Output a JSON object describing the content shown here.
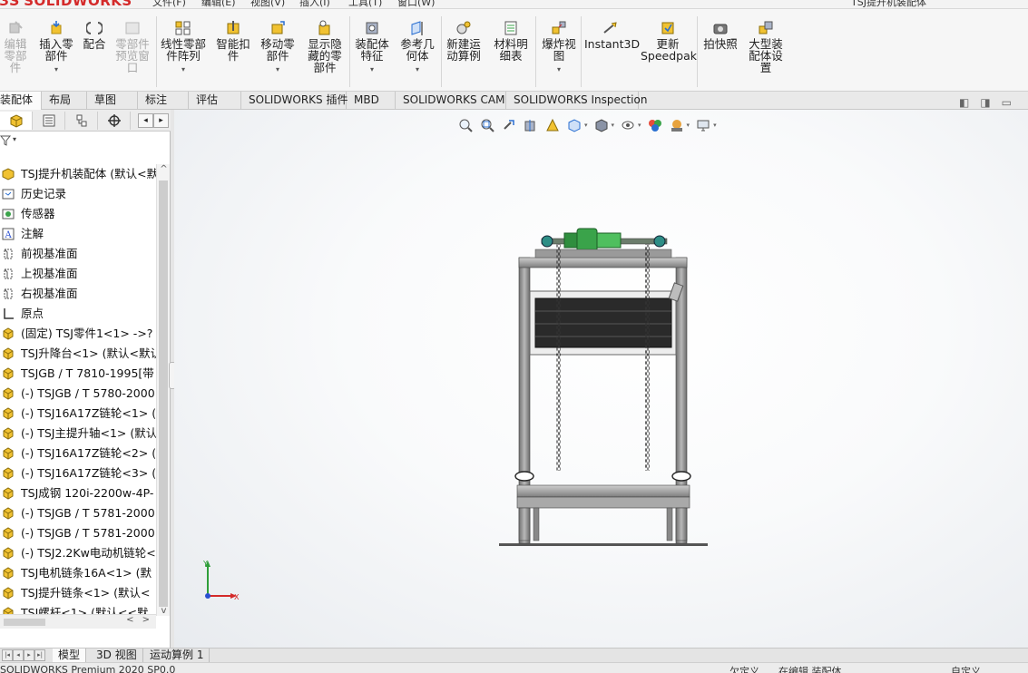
{
  "brand": {
    "name": "SOLIDWORKS"
  },
  "menu": {
    "items": [
      "文件(F)",
      "编辑(E)",
      "视图(V)",
      "插入(I)",
      "工具(T)",
      "窗口(W)"
    ],
    "title": "TSJ提升机装配体"
  },
  "ribbon": {
    "buttons": [
      {
        "label": "编辑零部件",
        "icon": "edit-component-icon",
        "disabled": true
      },
      {
        "label": "插入零部件",
        "icon": "insert-component-icon",
        "disabled": false,
        "dropdown": true
      },
      {
        "label": "配合",
        "icon": "mate-icon",
        "disabled": false
      },
      {
        "label": "零部件预览窗口",
        "icon": "component-preview-icon",
        "disabled": true
      },
      {
        "label": "线性零部件阵列",
        "icon": "linear-pattern-icon",
        "disabled": false,
        "dropdown": true
      },
      {
        "label": "智能扣件",
        "icon": "smart-fasteners-icon",
        "disabled": false
      },
      {
        "label": "移动零部件",
        "icon": "move-component-icon",
        "disabled": false,
        "dropdown": true
      },
      {
        "label": "显示隐藏的零部件",
        "icon": "show-hidden-icon",
        "disabled": false
      },
      {
        "label": "装配体特征",
        "icon": "assembly-feature-icon",
        "disabled": false,
        "dropdown": true
      },
      {
        "label": "参考几何体",
        "icon": "reference-geometry-icon",
        "disabled": false,
        "dropdown": true
      },
      {
        "label": "新建运动算例",
        "icon": "motion-study-icon",
        "disabled": false
      },
      {
        "label": "材料明细表",
        "icon": "bom-icon",
        "disabled": false
      },
      {
        "label": "爆炸视图",
        "icon": "exploded-view-icon",
        "disabled": false,
        "dropdown": true
      },
      {
        "label": "Instant3D",
        "icon": "instant3d-icon",
        "disabled": false
      },
      {
        "label": "更新Speedpak",
        "icon": "speedpak-icon",
        "disabled": false
      },
      {
        "label": "拍快照",
        "icon": "snapshot-icon",
        "disabled": false
      },
      {
        "label": "大型装配体设置",
        "icon": "large-assembly-icon",
        "disabled": false
      }
    ]
  },
  "cm_tabs": [
    "装配体",
    "布局",
    "草图",
    "标注",
    "评估",
    "SOLIDWORKS 插件",
    "MBD",
    "SOLIDWORKS CAM",
    "SOLIDWORKS Inspection"
  ],
  "cm_active": "装配体",
  "feature_tree": {
    "root": "TSJ提升机装配体 (默认<默认",
    "items": [
      {
        "label": "历史记录",
        "icon": "history-icon"
      },
      {
        "label": "传感器",
        "icon": "sensor-icon"
      },
      {
        "label": "注解",
        "icon": "annotation-icon"
      },
      {
        "label": "前视基准面",
        "icon": "plane-icon"
      },
      {
        "label": "上视基准面",
        "icon": "plane-icon"
      },
      {
        "label": "右视基准面",
        "icon": "plane-icon"
      },
      {
        "label": "原点",
        "icon": "origin-icon"
      },
      {
        "label": "(固定) TSJ零件1<1> ->?",
        "icon": "part-icon"
      },
      {
        "label": "TSJ升降台<1> (默认<默认",
        "icon": "part-icon"
      },
      {
        "label": "TSJGB / T 7810-1995[带",
        "icon": "part-icon"
      },
      {
        "label": "(-) TSJGB / T 5780-2000",
        "icon": "part-icon"
      },
      {
        "label": "(-) TSJ16A17Z链轮<1> (",
        "icon": "part-icon"
      },
      {
        "label": "(-) TSJ主提升轴<1> (默认",
        "icon": "part-icon"
      },
      {
        "label": "(-) TSJ16A17Z链轮<2> (",
        "icon": "part-icon"
      },
      {
        "label": "(-) TSJ16A17Z链轮<3> (",
        "icon": "part-icon"
      },
      {
        "label": "TSJ成钢 120i-2200w-4P-",
        "icon": "part-icon"
      },
      {
        "label": "(-) TSJGB / T 5781-2000",
        "icon": "part-icon"
      },
      {
        "label": "(-) TSJGB / T 5781-2000",
        "icon": "part-icon"
      },
      {
        "label": "(-) TSJ2.2Kw电动机链轮<",
        "icon": "part-icon"
      },
      {
        "label": "TSJ电机链条16A<1> (默",
        "icon": "part-icon"
      },
      {
        "label": "TSJ提升链条<1> (默认<",
        "icon": "part-icon"
      },
      {
        "label": "TSJ螺杆<1> (默认<<默",
        "icon": "part-icon"
      }
    ]
  },
  "triad": {
    "x": "X",
    "y": "Y"
  },
  "bottom_tabs": [
    "模型",
    "3D 视图",
    "运动算例 1"
  ],
  "bottom_active": "模型",
  "status": {
    "left": "SOLIDWORKS Premium 2020 SP0.0",
    "mid1": "欠定义",
    "mid2": "在编辑 装配体",
    "right": "自定义"
  },
  "colors": {
    "accent": "#d42a2a",
    "viewport_bg": "#f7f8fa",
    "motor": "#3aa34a",
    "frame": "#8a8a8a"
  }
}
